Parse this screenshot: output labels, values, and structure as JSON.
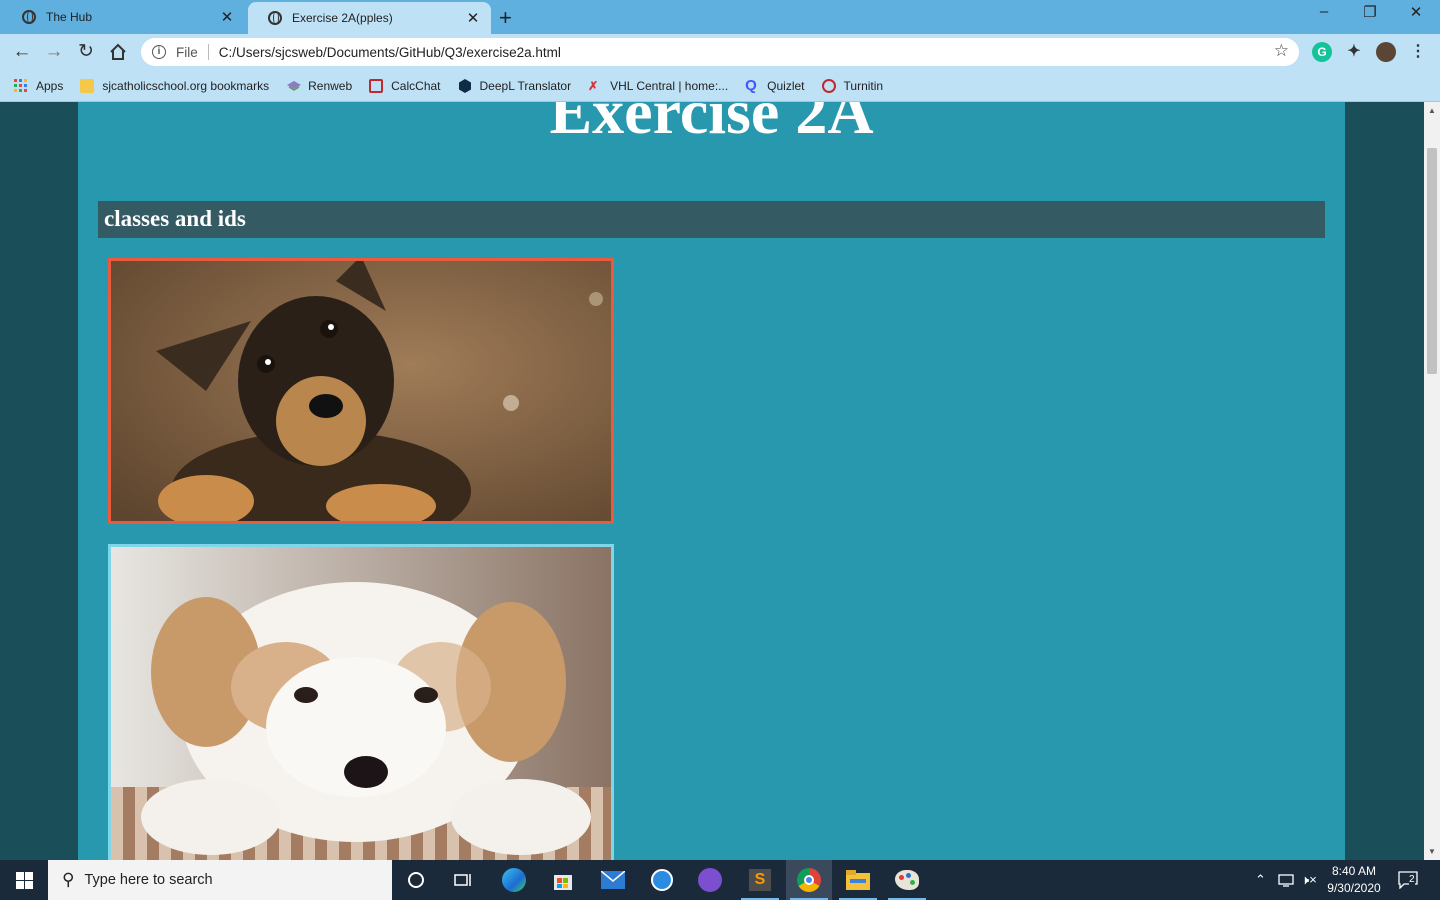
{
  "browser": {
    "tabs": [
      {
        "title": "The Hub",
        "active": false
      },
      {
        "title": "Exercise 2A(pples)",
        "active": true
      }
    ],
    "close_glyph": "✕",
    "new_tab_glyph": "+",
    "window_controls": {
      "minimize": "–",
      "maximize": "❐",
      "close": "✕"
    },
    "omnibox": {
      "scheme_label": "File",
      "url": "C:/Users/sjcsweb/Documents/GitHub/Q3/exercise2a.html"
    },
    "nav_icons": [
      "back-icon",
      "forward-icon",
      "reload-icon",
      "home-icon"
    ],
    "bookmarks": [
      {
        "label": "Apps",
        "icon": "apps-grid-icon"
      },
      {
        "label": "sjcatholicschool.org bookmarks",
        "icon": "folder-icon"
      },
      {
        "label": "Renweb",
        "icon": "renweb-icon"
      },
      {
        "label": "CalcChat",
        "icon": "calcchat-icon"
      },
      {
        "label": "DeepL Translator",
        "icon": "deepl-icon"
      },
      {
        "label": "VHL Central | home:...",
        "icon": "vhl-icon"
      },
      {
        "label": "Quizlet",
        "icon": "quizlet-icon"
      },
      {
        "label": "Turnitin",
        "icon": "turnitin-icon"
      }
    ]
  },
  "page": {
    "heading": "Exercise 2A",
    "subheading": "classes and ids",
    "images": [
      {
        "description_icon": "puppy-photo-black-tan",
        "border_color": "#ea5a3c"
      },
      {
        "description_icon": "puppy-photo-white-fluffy",
        "border_color": "#7ed6e8"
      }
    ],
    "colors": {
      "background": "#1a4f5a",
      "content": "#2898ae",
      "subheading_bar": "#345a63"
    }
  },
  "taskbar": {
    "search_placeholder": "Type here to search",
    "time": "8:40 AM",
    "date": "9/30/2020",
    "notification_count": "2"
  }
}
